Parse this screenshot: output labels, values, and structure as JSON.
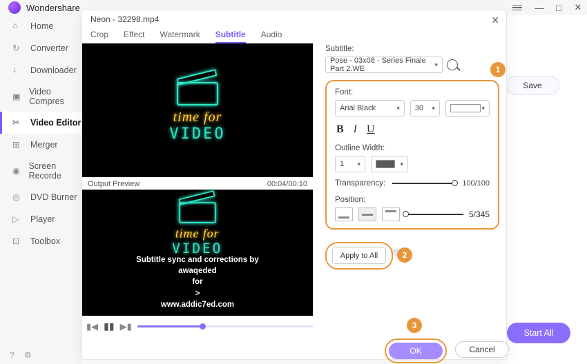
{
  "app": {
    "brand": "Wondershare"
  },
  "window": {
    "menu": "≡",
    "min": "—",
    "max": "□",
    "close": "✕"
  },
  "sidebar": {
    "items": [
      {
        "label": "Home"
      },
      {
        "label": "Converter"
      },
      {
        "label": "Downloader"
      },
      {
        "label": "Video Compres"
      },
      {
        "label": "Video Editor"
      },
      {
        "label": "Merger"
      },
      {
        "label": "Screen Recorde"
      },
      {
        "label": "DVD Burner"
      },
      {
        "label": "Player"
      },
      {
        "label": "Toolbox"
      }
    ]
  },
  "behind": {
    "save": "Save",
    "startAll": "Start All"
  },
  "modal": {
    "title": "Neon - 32298.mp4",
    "close": "✕",
    "tabs": [
      "Crop",
      "Effect",
      "Watermark",
      "Subtitle",
      "Audio"
    ],
    "previewLabel": "Output Preview",
    "time": "00:04/00:10",
    "neon1": "time for",
    "neon2": "VIDEO",
    "subtitleText": {
      "l1": "Subtitle sync and corrections by",
      "l2": "awaqeded",
      "l3": "for",
      "l4": ">",
      "l5": "www.addic7ed.com"
    },
    "panel": {
      "subtitleLbl": "Subtitle:",
      "subtitleVal": "Pose - 03x08 - Series Finale Part 2.WE",
      "fontLbl": "Font:",
      "fontName": "Arial Black",
      "fontSize": "30",
      "bold": "B",
      "italic": "I",
      "underline": "U",
      "outlineLbl": "Outline Width:",
      "outlineVal": "1",
      "transLbl": "Transparency:",
      "transVal": "100/100",
      "posLbl": "Position:",
      "posVal": "5/345",
      "applyAll": "Apply to All",
      "ok": "OK",
      "cancel": "Cancel"
    },
    "annot": {
      "n1": "1",
      "n2": "2",
      "n3": "3"
    }
  }
}
